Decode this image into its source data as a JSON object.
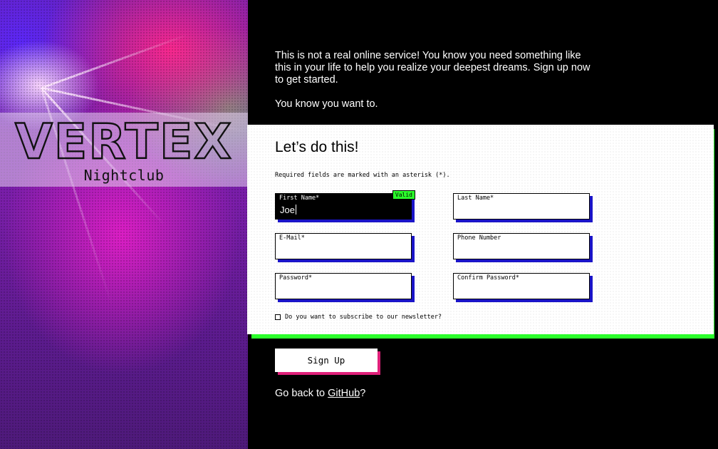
{
  "brand": {
    "name": "VERTEX",
    "subtitle": "Nightclub"
  },
  "intro": {
    "line1": "This is not a real online service! You know you need something like this in your life to help you realize your deepest dreams. Sign up now to get started.",
    "line2": "You know you want to."
  },
  "form": {
    "title": "Let’s do this!",
    "required_note": "Required fields are marked with an asterisk (*).",
    "fields": {
      "first_name": {
        "label": "First Name*",
        "value": "Joe",
        "status": "Valid"
      },
      "last_name": {
        "label": "Last Name*",
        "value": ""
      },
      "email": {
        "label": "E-Mail*",
        "value": ""
      },
      "phone": {
        "label": "Phone Number",
        "value": ""
      },
      "password": {
        "label": "Password*",
        "value": ""
      },
      "confirm_password": {
        "label": "Confirm Password*",
        "value": ""
      }
    },
    "newsletter_label": "Do you want to subscribe to our newsletter?",
    "submit_label": "Sign Up"
  },
  "footer": {
    "prefix": "Go back to ",
    "link_text": "GitHub",
    "suffix": "?"
  },
  "colors": {
    "accent_green": "#2bff2b",
    "field_shadow": "#1a14c8",
    "button_shadow": "#e0207a"
  },
  "icons": {
    "newsletter_checkbox": "checkbox-icon"
  }
}
